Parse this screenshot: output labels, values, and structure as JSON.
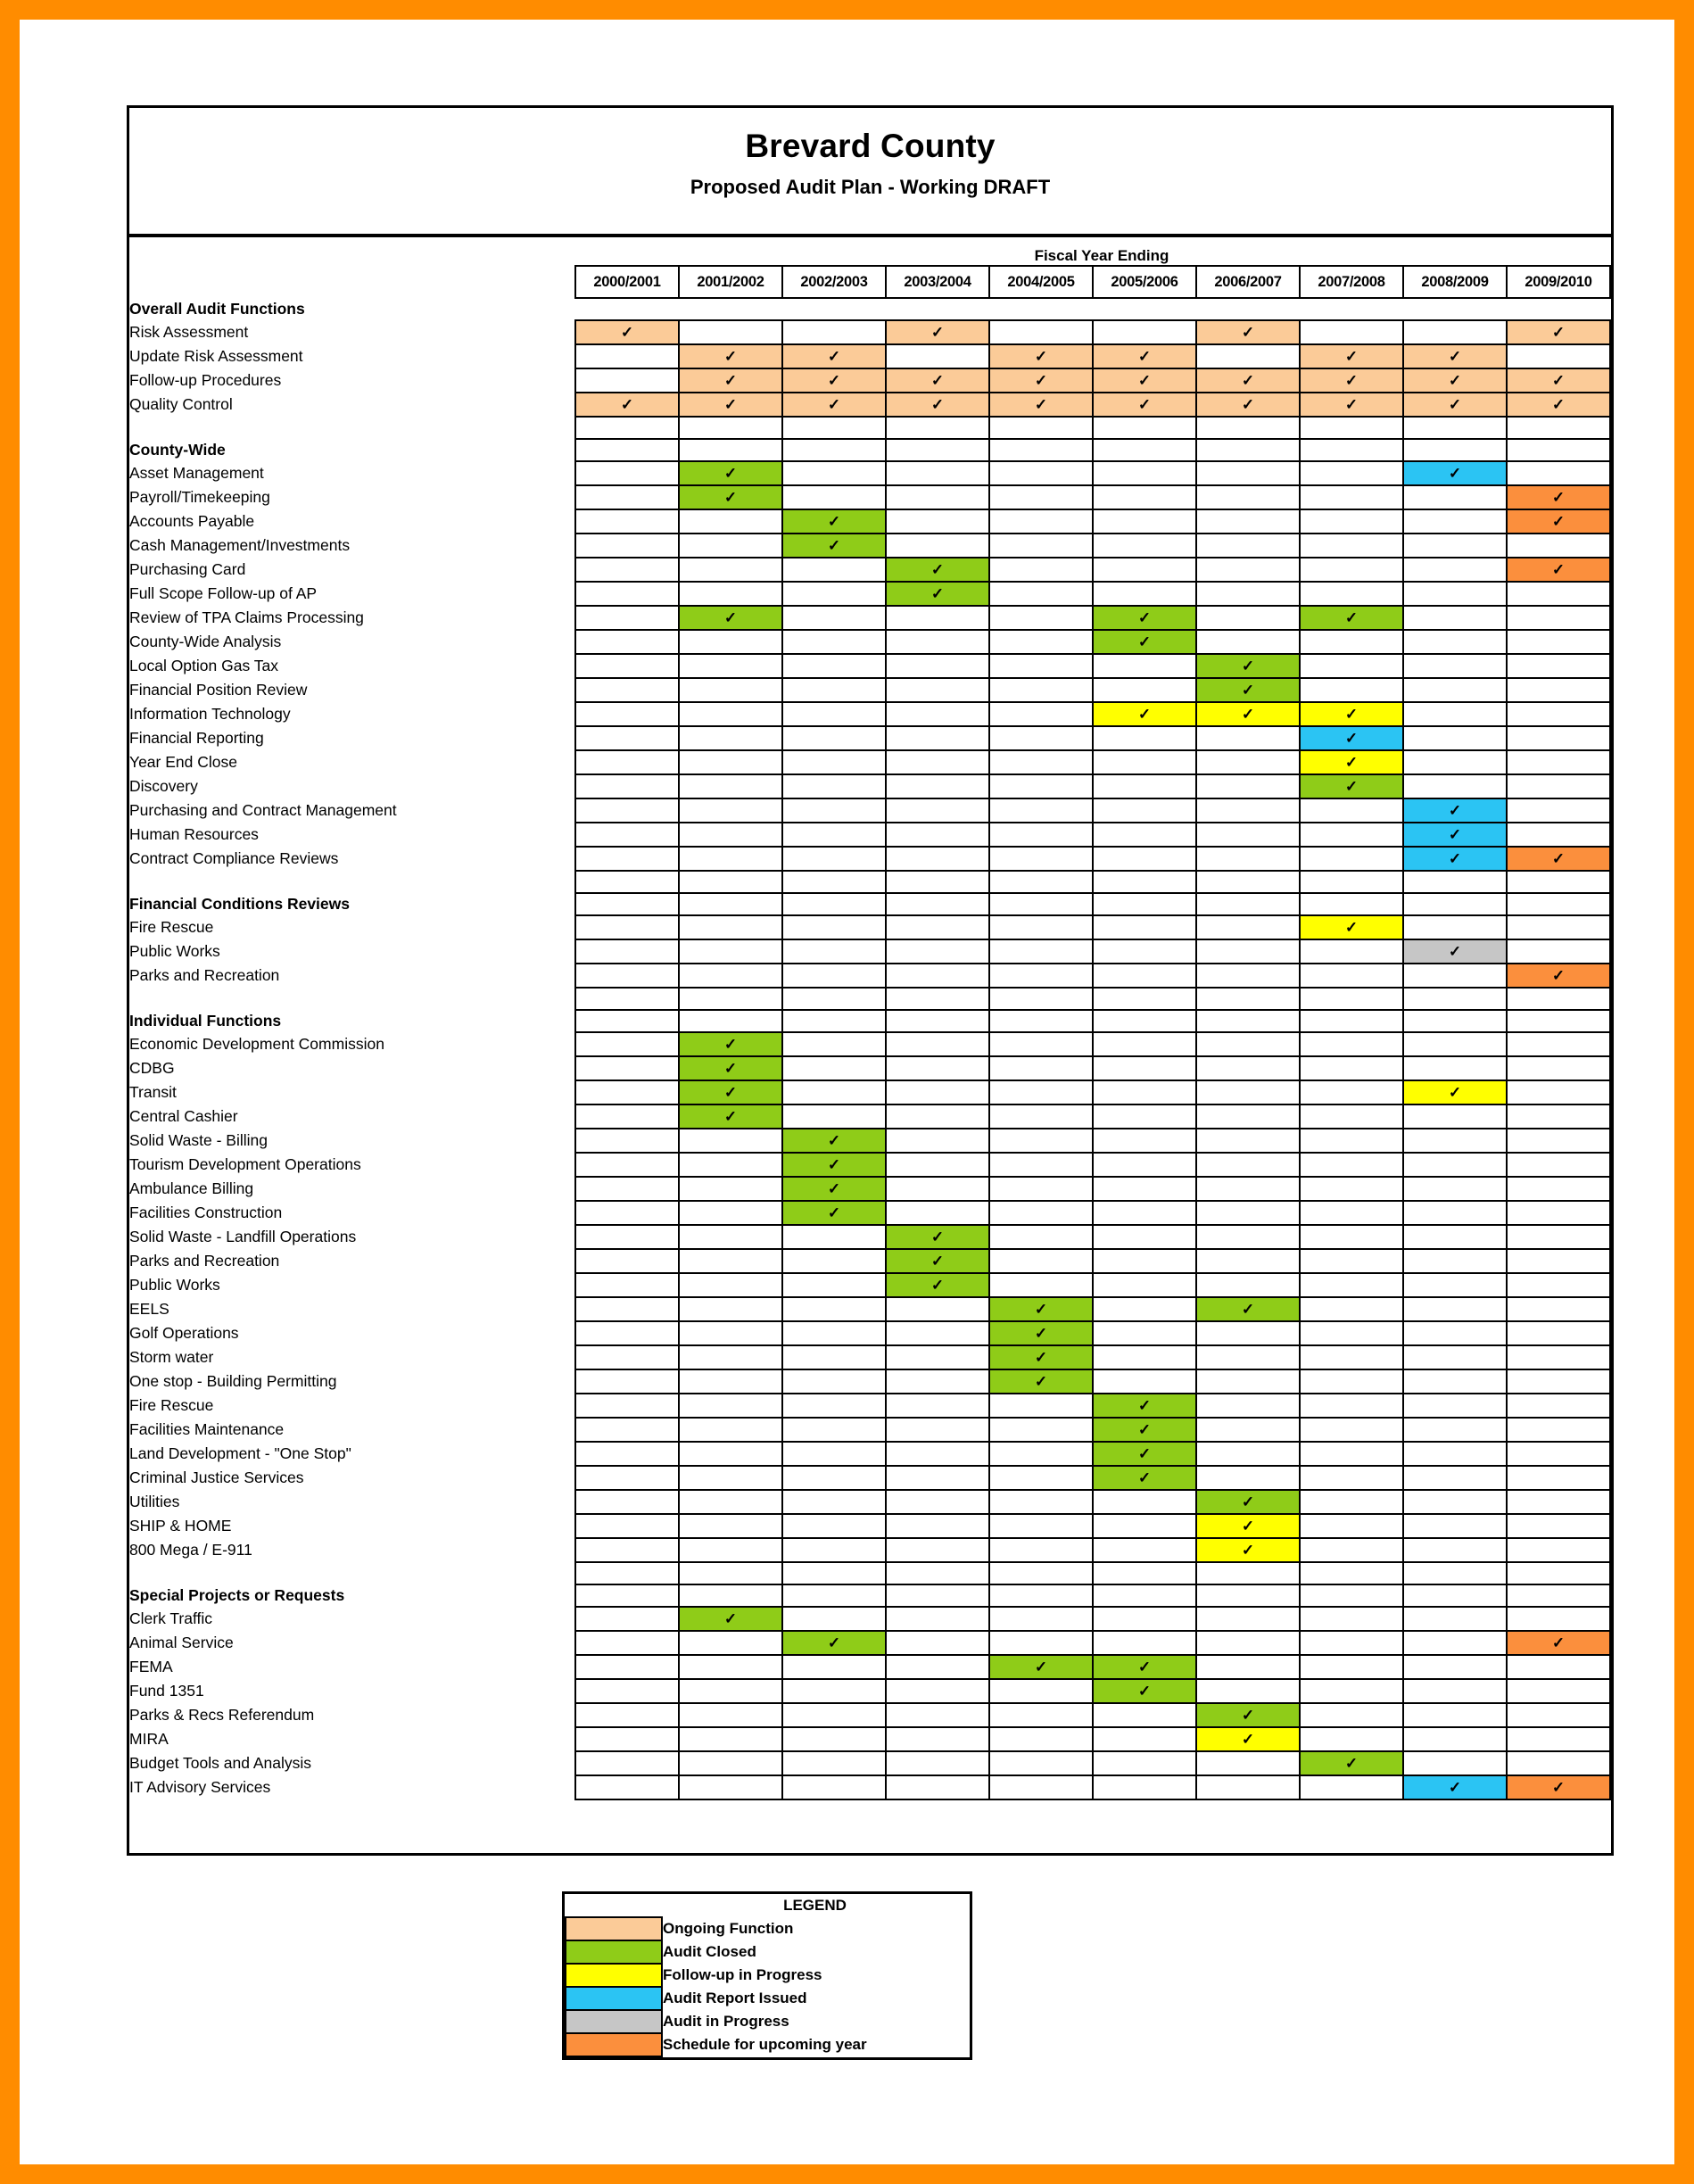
{
  "document": {
    "title": "Brevard County",
    "subtitle": "Proposed Audit Plan - Working DRAFT",
    "fiscal_caption": "Fiscal Year Ending"
  },
  "columns": [
    "2000/2001",
    "2001/2002",
    "2002/2003",
    "2003/2004",
    "2004/2005",
    "2005/2006",
    "2006/2007",
    "2007/2008",
    "2008/2009",
    "2009/2010"
  ],
  "check_glyph": "✓",
  "status_colors": {
    "ongoing": "#fbcb98",
    "closed": "#8fcc18",
    "followup": "#ffff00",
    "issued": "#2bc4f3",
    "inprogress": "#c6c6c6",
    "upcoming": "#fb8f3d"
  },
  "legend": {
    "title": "LEGEND",
    "items": [
      {
        "label": "Ongoing Function",
        "status": "ongoing"
      },
      {
        "label": "Audit Closed",
        "status": "closed"
      },
      {
        "label": "Follow-up in Progress",
        "status": "followup"
      },
      {
        "label": "Audit Report Issued",
        "status": "issued"
      },
      {
        "label": "Audit in Progress",
        "status": "inprogress"
      },
      {
        "label": "Schedule for upcoming year",
        "status": "upcoming"
      }
    ]
  },
  "rows": [
    {
      "label": "Overall Audit Functions",
      "kind": "section",
      "grid": false,
      "cells": []
    },
    {
      "label": "Risk Assessment",
      "kind": "item",
      "grid": true,
      "cells": [
        "ongoing",
        "",
        "",
        "ongoing",
        "",
        "",
        "ongoing",
        "",
        "",
        "ongoing"
      ]
    },
    {
      "label": "Update Risk Assessment",
      "kind": "item",
      "grid": true,
      "cells": [
        "",
        "ongoing",
        "ongoing",
        "",
        "ongoing",
        "ongoing",
        "",
        "ongoing",
        "ongoing",
        ""
      ]
    },
    {
      "label": "Follow-up Procedures",
      "kind": "item",
      "grid": true,
      "cells": [
        "",
        "ongoing",
        "ongoing",
        "ongoing",
        "ongoing",
        "ongoing",
        "ongoing",
        "ongoing",
        "ongoing",
        "ongoing"
      ]
    },
    {
      "label": "Quality Control",
      "kind": "item",
      "grid": true,
      "cells": [
        "ongoing",
        "ongoing",
        "ongoing",
        "ongoing",
        "ongoing",
        "ongoing",
        "ongoing",
        "ongoing",
        "ongoing",
        "ongoing"
      ]
    },
    {
      "label": "",
      "kind": "blank",
      "grid": true,
      "cells": [
        "",
        "",
        "",
        "",
        "",
        "",
        "",
        "",
        "",
        ""
      ]
    },
    {
      "label": "County-Wide",
      "kind": "section",
      "grid": true,
      "cells": [
        "",
        "",
        "",
        "",
        "",
        "",
        "",
        "",
        "",
        ""
      ]
    },
    {
      "label": "Asset Management",
      "kind": "item",
      "grid": true,
      "cells": [
        "",
        "closed",
        "",
        "",
        "",
        "",
        "",
        "",
        "issued",
        ""
      ]
    },
    {
      "label": "Payroll/Timekeeping",
      "kind": "item",
      "grid": true,
      "cells": [
        "",
        "closed",
        "",
        "",
        "",
        "",
        "",
        "",
        "",
        "upcoming"
      ]
    },
    {
      "label": "Accounts Payable",
      "kind": "item",
      "grid": true,
      "cells": [
        "",
        "",
        "closed",
        "",
        "",
        "",
        "",
        "",
        "",
        "upcoming"
      ]
    },
    {
      "label": "Cash Management/Investments",
      "kind": "item",
      "grid": true,
      "cells": [
        "",
        "",
        "closed",
        "",
        "",
        "",
        "",
        "",
        "",
        ""
      ]
    },
    {
      "label": "Purchasing Card",
      "kind": "item",
      "grid": true,
      "cells": [
        "",
        "",
        "",
        "closed",
        "",
        "",
        "",
        "",
        "",
        "upcoming"
      ]
    },
    {
      "label": "Full Scope Follow-up of AP",
      "kind": "item",
      "grid": true,
      "cells": [
        "",
        "",
        "",
        "closed",
        "",
        "",
        "",
        "",
        "",
        ""
      ]
    },
    {
      "label": "Review of TPA Claims Processing",
      "kind": "item",
      "grid": true,
      "cells": [
        "",
        "closed",
        "",
        "",
        "",
        "closed",
        "",
        "closed",
        "",
        ""
      ]
    },
    {
      "label": "County-Wide Analysis",
      "kind": "item",
      "grid": true,
      "cells": [
        "",
        "",
        "",
        "",
        "",
        "closed",
        "",
        "",
        "",
        ""
      ]
    },
    {
      "label": "Local Option Gas Tax",
      "kind": "item",
      "grid": true,
      "cells": [
        "",
        "",
        "",
        "",
        "",
        "",
        "closed",
        "",
        "",
        ""
      ]
    },
    {
      "label": "Financial Position Review",
      "kind": "item",
      "grid": true,
      "cells": [
        "",
        "",
        "",
        "",
        "",
        "",
        "closed",
        "",
        "",
        ""
      ]
    },
    {
      "label": "Information Technology",
      "kind": "item",
      "grid": true,
      "cells": [
        "",
        "",
        "",
        "",
        "",
        "followup",
        "followup",
        "followup",
        "",
        ""
      ]
    },
    {
      "label": "Financial Reporting",
      "kind": "item",
      "grid": true,
      "cells": [
        "",
        "",
        "",
        "",
        "",
        "",
        "",
        "issued",
        "",
        ""
      ]
    },
    {
      "label": "Year End Close",
      "kind": "item",
      "grid": true,
      "cells": [
        "",
        "",
        "",
        "",
        "",
        "",
        "",
        "followup",
        "",
        ""
      ]
    },
    {
      "label": "Discovery",
      "kind": "item",
      "grid": true,
      "cells": [
        "",
        "",
        "",
        "",
        "",
        "",
        "",
        "closed",
        "",
        ""
      ]
    },
    {
      "label": "Purchasing and Contract Management",
      "kind": "item",
      "grid": true,
      "cells": [
        "",
        "",
        "",
        "",
        "",
        "",
        "",
        "",
        "issued",
        ""
      ]
    },
    {
      "label": "Human Resources",
      "kind": "item",
      "grid": true,
      "cells": [
        "",
        "",
        "",
        "",
        "",
        "",
        "",
        "",
        "issued",
        ""
      ]
    },
    {
      "label": "Contract Compliance Reviews",
      "kind": "item",
      "grid": true,
      "cells": [
        "",
        "",
        "",
        "",
        "",
        "",
        "",
        "",
        "issued",
        "upcoming"
      ]
    },
    {
      "label": "",
      "kind": "blank",
      "grid": true,
      "cells": [
        "",
        "",
        "",
        "",
        "",
        "",
        "",
        "",
        "",
        ""
      ]
    },
    {
      "label": "Financial Conditions Reviews",
      "kind": "section",
      "grid": true,
      "cells": [
        "",
        "",
        "",
        "",
        "",
        "",
        "",
        "",
        "",
        ""
      ]
    },
    {
      "label": "Fire Rescue",
      "kind": "item",
      "grid": true,
      "cells": [
        "",
        "",
        "",
        "",
        "",
        "",
        "",
        "followup",
        "",
        ""
      ]
    },
    {
      "label": "Public Works",
      "kind": "item",
      "grid": true,
      "cells": [
        "",
        "",
        "",
        "",
        "",
        "",
        "",
        "",
        "inprogress",
        ""
      ]
    },
    {
      "label": "Parks and Recreation",
      "kind": "item",
      "grid": true,
      "cells": [
        "",
        "",
        "",
        "",
        "",
        "",
        "",
        "",
        "",
        "upcoming"
      ]
    },
    {
      "label": "",
      "kind": "blank",
      "grid": true,
      "cells": [
        "",
        "",
        "",
        "",
        "",
        "",
        "",
        "",
        "",
        ""
      ]
    },
    {
      "label": "Individual Functions",
      "kind": "section",
      "grid": true,
      "cells": [
        "",
        "",
        "",
        "",
        "",
        "",
        "",
        "",
        "",
        ""
      ]
    },
    {
      "label": "Economic Development Commission",
      "kind": "item",
      "grid": true,
      "cells": [
        "",
        "closed",
        "",
        "",
        "",
        "",
        "",
        "",
        "",
        ""
      ]
    },
    {
      "label": "CDBG",
      "kind": "item",
      "grid": true,
      "cells": [
        "",
        "closed",
        "",
        "",
        "",
        "",
        "",
        "",
        "",
        ""
      ]
    },
    {
      "label": "Transit",
      "kind": "item",
      "grid": true,
      "cells": [
        "",
        "closed",
        "",
        "",
        "",
        "",
        "",
        "",
        "followup",
        ""
      ]
    },
    {
      "label": "Central Cashier",
      "kind": "item",
      "grid": true,
      "cells": [
        "",
        "closed",
        "",
        "",
        "",
        "",
        "",
        "",
        "",
        ""
      ]
    },
    {
      "label": "Solid Waste - Billing",
      "kind": "item",
      "grid": true,
      "cells": [
        "",
        "",
        "closed",
        "",
        "",
        "",
        "",
        "",
        "",
        ""
      ]
    },
    {
      "label": "Tourism Development Operations",
      "kind": "item",
      "grid": true,
      "cells": [
        "",
        "",
        "closed",
        "",
        "",
        "",
        "",
        "",
        "",
        ""
      ]
    },
    {
      "label": "Ambulance Billing",
      "kind": "item",
      "grid": true,
      "cells": [
        "",
        "",
        "closed",
        "",
        "",
        "",
        "",
        "",
        "",
        ""
      ]
    },
    {
      "label": "Facilities Construction",
      "kind": "item",
      "grid": true,
      "cells": [
        "",
        "",
        "closed",
        "",
        "",
        "",
        "",
        "",
        "",
        ""
      ]
    },
    {
      "label": "Solid Waste - Landfill Operations",
      "kind": "item",
      "grid": true,
      "cells": [
        "",
        "",
        "",
        "closed",
        "",
        "",
        "",
        "",
        "",
        ""
      ]
    },
    {
      "label": "Parks and Recreation",
      "kind": "item",
      "grid": true,
      "cells": [
        "",
        "",
        "",
        "closed",
        "",
        "",
        "",
        "",
        "",
        ""
      ]
    },
    {
      "label": "Public Works",
      "kind": "item",
      "grid": true,
      "cells": [
        "",
        "",
        "",
        "closed",
        "",
        "",
        "",
        "",
        "",
        ""
      ]
    },
    {
      "label": "EELS",
      "kind": "item",
      "grid": true,
      "cells": [
        "",
        "",
        "",
        "",
        "closed",
        "",
        "closed",
        "",
        "",
        ""
      ]
    },
    {
      "label": "Golf Operations",
      "kind": "item",
      "grid": true,
      "cells": [
        "",
        "",
        "",
        "",
        "closed",
        "",
        "",
        "",
        "",
        ""
      ]
    },
    {
      "label": "Storm water",
      "kind": "item",
      "grid": true,
      "cells": [
        "",
        "",
        "",
        "",
        "closed",
        "",
        "",
        "",
        "",
        ""
      ]
    },
    {
      "label": "One stop - Building Permitting",
      "kind": "item",
      "grid": true,
      "cells": [
        "",
        "",
        "",
        "",
        "closed",
        "",
        "",
        "",
        "",
        ""
      ]
    },
    {
      "label": "Fire Rescue",
      "kind": "item",
      "grid": true,
      "cells": [
        "",
        "",
        "",
        "",
        "",
        "closed",
        "",
        "",
        "",
        ""
      ]
    },
    {
      "label": "Facilities Maintenance",
      "kind": "item",
      "grid": true,
      "cells": [
        "",
        "",
        "",
        "",
        "",
        "closed",
        "",
        "",
        "",
        ""
      ]
    },
    {
      "label": "Land Development - \"One Stop\"",
      "kind": "item",
      "grid": true,
      "cells": [
        "",
        "",
        "",
        "",
        "",
        "closed",
        "",
        "",
        "",
        ""
      ]
    },
    {
      "label": "Criminal Justice Services",
      "kind": "item",
      "grid": true,
      "cells": [
        "",
        "",
        "",
        "",
        "",
        "closed",
        "",
        "",
        "",
        ""
      ]
    },
    {
      "label": "Utilities",
      "kind": "item",
      "grid": true,
      "cells": [
        "",
        "",
        "",
        "",
        "",
        "",
        "closed",
        "",
        "",
        ""
      ]
    },
    {
      "label": "SHIP & HOME",
      "kind": "item",
      "grid": true,
      "cells": [
        "",
        "",
        "",
        "",
        "",
        "",
        "followup",
        "",
        "",
        ""
      ]
    },
    {
      "label": "800 Mega / E-911",
      "kind": "item",
      "grid": true,
      "cells": [
        "",
        "",
        "",
        "",
        "",
        "",
        "followup",
        "",
        "",
        ""
      ]
    },
    {
      "label": "",
      "kind": "blank",
      "grid": true,
      "cells": [
        "",
        "",
        "",
        "",
        "",
        "",
        "",
        "",
        "",
        ""
      ]
    },
    {
      "label": "Special Projects or Requests",
      "kind": "section",
      "grid": true,
      "cells": [
        "",
        "",
        "",
        "",
        "",
        "",
        "",
        "",
        "",
        ""
      ]
    },
    {
      "label": "Clerk Traffic",
      "kind": "item",
      "grid": true,
      "cells": [
        "",
        "closed",
        "",
        "",
        "",
        "",
        "",
        "",
        "",
        ""
      ]
    },
    {
      "label": "Animal Service",
      "kind": "item",
      "grid": true,
      "cells": [
        "",
        "",
        "closed",
        "",
        "",
        "",
        "",
        "",
        "",
        "upcoming"
      ]
    },
    {
      "label": "FEMA",
      "kind": "item",
      "grid": true,
      "cells": [
        "",
        "",
        "",
        "",
        "closed",
        "closed",
        "",
        "",
        "",
        ""
      ]
    },
    {
      "label": "Fund 1351",
      "kind": "item",
      "grid": true,
      "cells": [
        "",
        "",
        "",
        "",
        "",
        "closed",
        "",
        "",
        "",
        ""
      ]
    },
    {
      "label": "Parks & Recs Referendum",
      "kind": "item",
      "grid": true,
      "cells": [
        "",
        "",
        "",
        "",
        "",
        "",
        "closed",
        "",
        "",
        ""
      ]
    },
    {
      "label": "MIRA",
      "kind": "item",
      "grid": true,
      "cells": [
        "",
        "",
        "",
        "",
        "",
        "",
        "followup",
        "",
        "",
        ""
      ]
    },
    {
      "label": "Budget Tools and Analysis",
      "kind": "item",
      "grid": true,
      "cells": [
        "",
        "",
        "",
        "",
        "",
        "",
        "",
        "closed",
        "",
        ""
      ]
    },
    {
      "label": "IT Advisory Services",
      "kind": "item",
      "grid": true,
      "cells": [
        "",
        "",
        "",
        "",
        "",
        "",
        "",
        "",
        "issued",
        "upcoming"
      ]
    }
  ]
}
